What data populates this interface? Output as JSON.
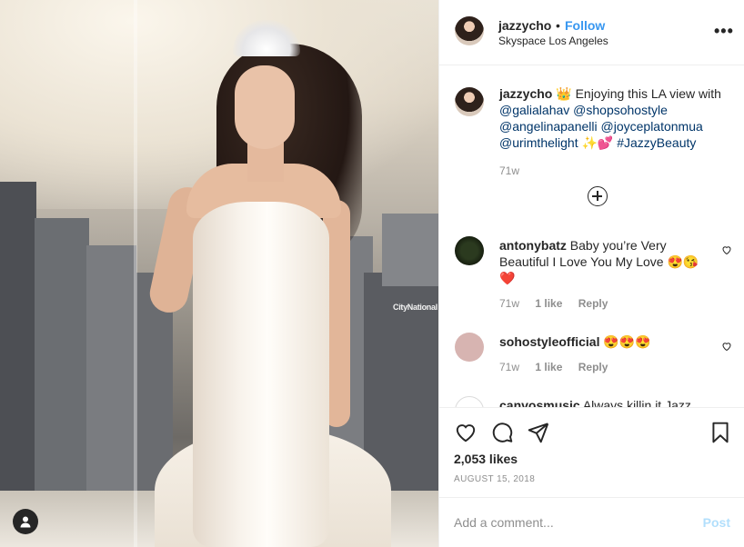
{
  "header": {
    "username": "jazzycho",
    "separator": "•",
    "follow_label": "Follow",
    "location": "Skyspace Los Angeles",
    "more_label": "•••"
  },
  "photo": {
    "sign_text": "CityNational"
  },
  "caption": {
    "username": "jazzycho",
    "emoji_crown": "👑",
    "text_start": " Enjoying this LA view with ",
    "tags": [
      "@galialahav",
      "@shopsohostyle",
      "@angelinapanelli",
      "@joyceplatonmua",
      "@urimthelight"
    ],
    "emoji_end": " ✨💕 ",
    "hashtag": "#JazzyBeauty",
    "time": "71w"
  },
  "comments": [
    {
      "username": "antonybatz",
      "text": " Baby you’re Very Beautiful I Love You My Love 😍😘❤️",
      "time": "71w",
      "likes": "1 like",
      "reply": "Reply"
    },
    {
      "username": "sohostyleofficial",
      "text": " 😍😍😍",
      "time": "71w",
      "likes": "1 like",
      "reply": "Reply"
    },
    {
      "username": "canvosmusic",
      "text": " Always killin it Jazz"
    }
  ],
  "actions": {
    "likes": "2,053 likes",
    "date": "AUGUST 15, 2018"
  },
  "add_comment": {
    "placeholder": "Add a comment...",
    "post_label": "Post"
  },
  "colors": {
    "link": "#3897f0",
    "tag": "#003569",
    "muted": "#8e8e8e",
    "post_disabled": "#b2dffc"
  }
}
